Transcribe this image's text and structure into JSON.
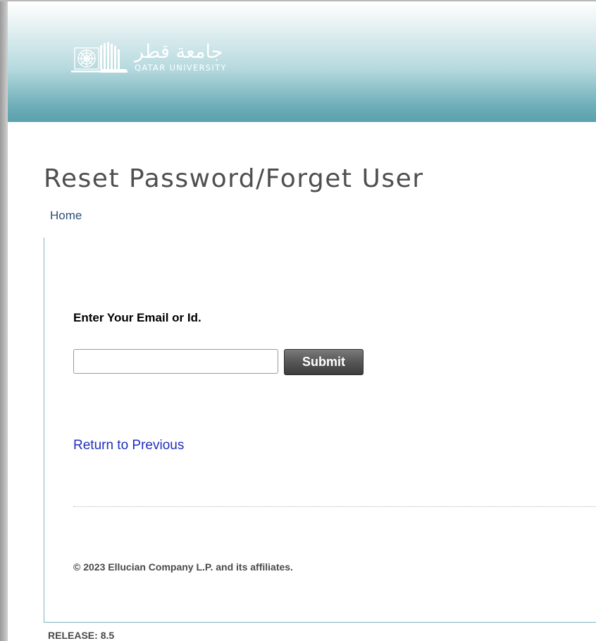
{
  "header": {
    "logo": {
      "arabic_name": "جامعة قطر",
      "english_name": "QATAR UNIVERSITY",
      "icon": "qatar-university-emblem"
    },
    "colors": {
      "banner_top": "#ffffff",
      "banner_bottom": "#5aa0ac"
    }
  },
  "page": {
    "title": "Reset Password/Forget User",
    "breadcrumb_home": "Home"
  },
  "form": {
    "prompt": "Enter Your Email or Id.",
    "input_value": "",
    "input_placeholder": "",
    "submit_label": "Submit"
  },
  "links": {
    "return_previous": "Return to Previous"
  },
  "footer": {
    "copyright": "© 2023 Ellucian Company L.P. and its affiliates.",
    "release_label": "RELEASE:",
    "release_version": "8.5"
  },
  "colors": {
    "link": "#1f2fbd",
    "home_link": "#2c4f77",
    "button": "#565656",
    "content_border": "#7fb3c0"
  }
}
